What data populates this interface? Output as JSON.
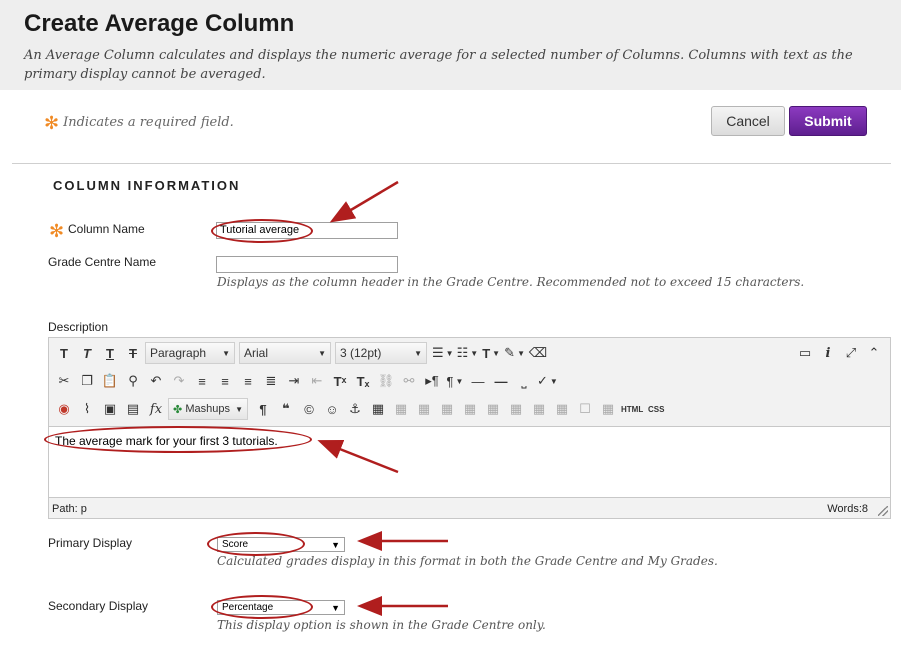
{
  "header": {
    "title": "Create Average Column",
    "subtitle": "An Average Column calculates and displays the numeric average for a selected number of Columns. Columns with text as the primary display cannot be averaged."
  },
  "required_note": "Indicates a required field.",
  "required_star": "✻",
  "buttons": {
    "cancel": "Cancel",
    "submit": "Submit"
  },
  "section": {
    "title": "COLUMN INFORMATION"
  },
  "column_name": {
    "label": "Column Name",
    "value": "Tutorial average"
  },
  "grade_centre_name": {
    "label": "Grade Centre Name",
    "value": "",
    "hint": "Displays as the column header in the Grade Centre. Recommended not to exceed 15 characters."
  },
  "description": {
    "label": "Description",
    "toolbar": {
      "paragraph": "Paragraph",
      "font": "Arial",
      "size": "3 (12pt)",
      "mashups": "Mashups",
      "html": "HTML",
      "css": "CSS"
    },
    "text": "The average mark for your first 3 tutorials.",
    "path_label": "Path: p",
    "words": "Words:8"
  },
  "primary_display": {
    "label": "Primary Display",
    "value": "Score",
    "hint": "Calculated grades display in this format in both the Grade Centre and My Grades."
  },
  "secondary_display": {
    "label": "Secondary Display",
    "value": "Percentage",
    "hint": "This display option is shown in the Grade Centre only."
  },
  "annotation_color": "#b01e1e",
  "accent_color": "#6a2a9c"
}
